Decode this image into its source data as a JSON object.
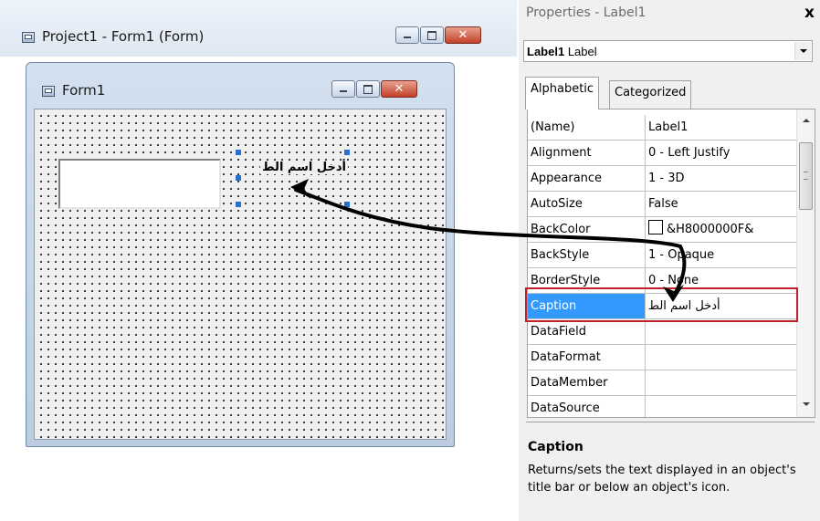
{
  "project_window": {
    "title": "Project1 - Form1 (Form)",
    "icon": "form-window-icon",
    "buttons": [
      "minimize-icon",
      "maximize-icon",
      "close-icon"
    ]
  },
  "form_window": {
    "title": "Form1",
    "textbox_value": "",
    "label_caption": "أدخل اسم الط"
  },
  "properties": {
    "title": "Properties - Label1",
    "close_glyph": "x",
    "object_name": "Label1",
    "object_type": "Label",
    "tabs": [
      {
        "label": "Alphabetic",
        "active": true
      },
      {
        "label": "Categorized",
        "active": false
      }
    ],
    "rows": [
      {
        "name": "(Name)",
        "value": "Label1"
      },
      {
        "name": "Alignment",
        "value": "0 - Left Justify"
      },
      {
        "name": "Appearance",
        "value": "1 - 3D"
      },
      {
        "name": "AutoSize",
        "value": "False"
      },
      {
        "name": "BackColor",
        "value": "&H8000000F&"
      },
      {
        "name": "BackStyle",
        "value": "1 - Opaque"
      },
      {
        "name": "BorderStyle",
        "value": "0 - None"
      },
      {
        "name": "Caption",
        "value": "أدخل اسم الط",
        "selected": true
      },
      {
        "name": "DataField",
        "value": ""
      },
      {
        "name": "DataFormat",
        "value": ""
      },
      {
        "name": "DataMember",
        "value": ""
      },
      {
        "name": "DataSource",
        "value": ""
      }
    ],
    "description": {
      "title": "Caption",
      "text": "Returns/sets the text displayed in an object's title bar or below an object's icon."
    }
  },
  "colors": {
    "selection": "#3399ff",
    "highlight_box": "#c0202a",
    "annotation_arrow": "#000000"
  }
}
